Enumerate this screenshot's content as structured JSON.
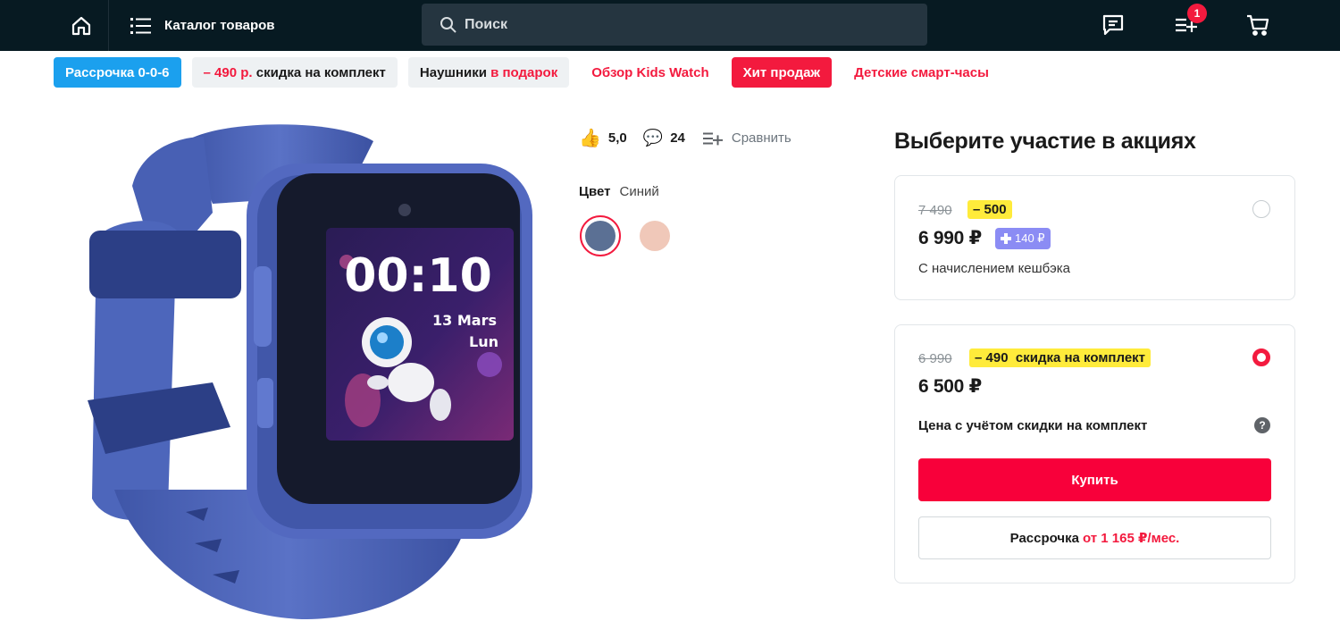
{
  "header": {
    "home_icon": "home-icon",
    "catalog_label": "Каталог товаров",
    "search_placeholder": "Поиск",
    "compare_count": "1",
    "icons": [
      "chat-icon",
      "compare-list-icon",
      "cart-icon"
    ]
  },
  "promo_chips": [
    {
      "label": "Рассрочка 0-0-6",
      "style": "blue"
    },
    {
      "prefix": "– 490 р.",
      "label": " скидка на комплект",
      "style": "grey"
    },
    {
      "label": "Наушники",
      "suffix": " в подарок",
      "style": "grey"
    },
    {
      "label": "Обзор Kids Watch",
      "style": "link"
    },
    {
      "label": "Хит продаж",
      "style": "red"
    },
    {
      "label": "Детские смарт-часы",
      "style": "link"
    }
  ],
  "product": {
    "image_alt": "Детские смарт-часы синие",
    "screen": {
      "time": "00:10",
      "date": "13 Mars",
      "day": "Lun"
    },
    "rating": "5,0",
    "reviews": "24",
    "compare_label": "Сравнить",
    "color_label": "Цвет",
    "color_value": "Синий",
    "colors": [
      "#5b7094",
      "#f0c8b9"
    ]
  },
  "promo_panel": {
    "title": "Выберите участие в акциях",
    "option1": {
      "old_price": "7 490",
      "discount": "– 500",
      "price": "6 990 ₽",
      "cashback": "140 ₽",
      "note": "С начислением кешбэка"
    },
    "option2": {
      "old_price": "6 990",
      "discount": "– 490  скидка на комплект",
      "price": "6 500 ₽",
      "note": "Цена с учётом скидки на комплект",
      "help": "?",
      "buy_label": "Купить",
      "installment_label": "Рассрочка",
      "installment_value": "от 1 165 ₽/мес."
    }
  },
  "colors": {
    "accent": "#f31a3e",
    "header_bg": "#071a22",
    "yellow": "#ffeb3b",
    "blue_chip": "#1ba0ee"
  }
}
